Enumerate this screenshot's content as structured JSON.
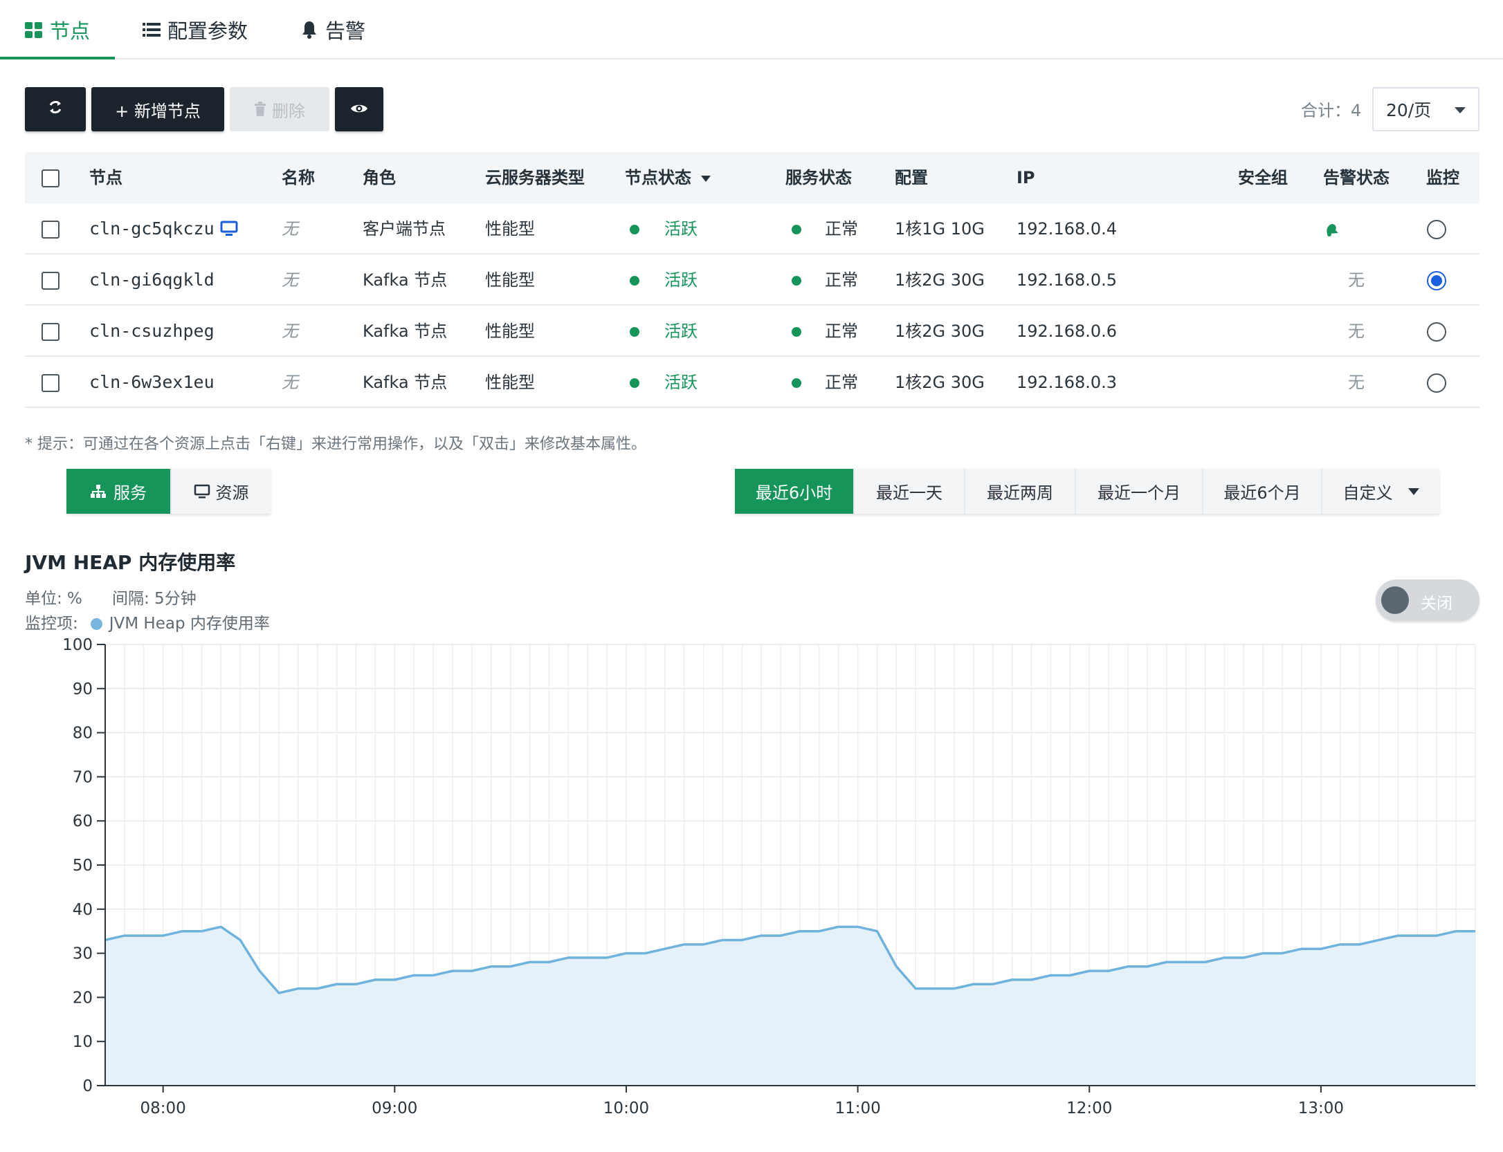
{
  "tabs": [
    {
      "label": "节点",
      "icon": "grid-icon",
      "active": true
    },
    {
      "label": "配置参数",
      "icon": "list-icon",
      "active": false
    },
    {
      "label": "告警",
      "icon": "bell-icon",
      "active": false
    }
  ],
  "toolbar": {
    "refresh_icon": "refresh-icon",
    "add_label": "+ 新增节点",
    "delete_label": "删除",
    "view_icon": "eye-icon"
  },
  "pagination": {
    "total": "合计：4",
    "page_size": "20/页"
  },
  "table": {
    "headers": [
      "节点",
      "名称",
      "角色",
      "云服务器类型",
      "节点状态",
      "服务状态",
      "配置",
      "IP",
      "安全组",
      "告警状态",
      "监控"
    ],
    "rows": [
      {
        "node": "cln-gc5qkczu",
        "name": "无",
        "role": "客户端节点",
        "type": "性能型",
        "node_status": "活跃",
        "service_status": "正常",
        "config": "1核1G 10G",
        "ip": "192.168.0.4",
        "alarm": "",
        "monitored": false
      },
      {
        "node": "cln-gi6qgkld",
        "name": "无",
        "role": "Kafka 节点",
        "type": "性能型",
        "node_status": "活跃",
        "service_status": "正常",
        "config": "1核2G 30G",
        "ip": "192.168.0.5",
        "alarm": "无",
        "monitored": true
      },
      {
        "node": "cln-csuzhpeg",
        "name": "无",
        "role": "Kafka 节点",
        "type": "性能型",
        "node_status": "活跃",
        "service_status": "正常",
        "config": "1核2G 30G",
        "ip": "192.168.0.6",
        "alarm": "无",
        "monitored": false
      },
      {
        "node": "cln-6w3ex1eu",
        "name": "无",
        "role": "Kafka 节点",
        "type": "性能型",
        "node_status": "活跃",
        "service_status": "正常",
        "config": "1核2G 30G",
        "ip": "192.168.0.3",
        "alarm": "无",
        "monitored": false
      }
    ]
  },
  "hint": "* 提示：可通过在各个资源上点击「右键」来进行常用操作，以及「双击」来修改基本属性。",
  "view_tabs": [
    {
      "label": "服务",
      "active": true
    },
    {
      "label": "资源",
      "active": false
    }
  ],
  "ranges": [
    {
      "label": "最近6小时",
      "active": true
    },
    {
      "label": "最近一天",
      "active": false
    },
    {
      "label": "最近两周",
      "active": false
    },
    {
      "label": "最近一个月",
      "active": false
    },
    {
      "label": "最近6个月",
      "active": false
    },
    {
      "label": "自定义",
      "active": false
    }
  ],
  "chart_meta": {
    "unit": "单位: %",
    "interval": "间隔: 5分钟",
    "monitor_label": "监控项:",
    "toggle_label": "关闭"
  },
  "colors": {
    "accent": "#15955a",
    "line": "#6fb3dc",
    "fill": "#e3f0f9",
    "radio": "#1a5fe0"
  },
  "chart_data": {
    "type": "area",
    "title": "JVM HEAP 内存使用率",
    "series": [
      {
        "name": "JVM Heap 内存使用率",
        "values": [
          33,
          34,
          34,
          34,
          35,
          35,
          36,
          33,
          26,
          21,
          22,
          22,
          23,
          23,
          24,
          24,
          25,
          25,
          26,
          26,
          27,
          27,
          28,
          28,
          29,
          29,
          29,
          30,
          30,
          31,
          32,
          32,
          33,
          33,
          34,
          34,
          35,
          35,
          36,
          36,
          35,
          27,
          22,
          22,
          22,
          23,
          23,
          24,
          24,
          25,
          25,
          26,
          26,
          27,
          27,
          28,
          28,
          28,
          29,
          29,
          30,
          30,
          31,
          31,
          32,
          32,
          33,
          34,
          34,
          34,
          35,
          35
        ]
      }
    ],
    "x_start": "07:45",
    "x_end": "13:40",
    "x_interval_minutes": 5,
    "x_ticks": [
      "08:00",
      "09:00",
      "10:00",
      "11:00",
      "12:00",
      "13:00"
    ],
    "y_ticks": [
      0,
      10,
      20,
      30,
      40,
      50,
      60,
      70,
      80,
      90,
      100
    ],
    "ylim": [
      0,
      100
    ],
    "grid": true
  }
}
